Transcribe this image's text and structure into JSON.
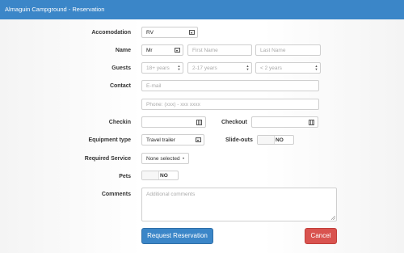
{
  "window": {
    "title": "Almaguin Campground - Reservation"
  },
  "form": {
    "accommodation": {
      "label": "Accomodation",
      "value": "RV"
    },
    "name": {
      "label": "Name",
      "title_value": "Mr",
      "first_placeholder": "First Name",
      "last_placeholder": "Last Name"
    },
    "guests": {
      "label": "Guests",
      "adults_placeholder": "18+ years",
      "children_placeholder": "2-17 years",
      "infants_placeholder": "< 2 years"
    },
    "contact": {
      "label": "Contact",
      "email_placeholder": "E-mail",
      "phone_placeholder": "Phone: (xxx) - xxx xxxx"
    },
    "checkin": {
      "label": "Checkin",
      "value": ""
    },
    "checkout": {
      "label": "Checkout",
      "value": ""
    },
    "equipment": {
      "label": "Equipment type",
      "value": "Travel trailer"
    },
    "slideouts": {
      "label": "Slide-outs",
      "value": "NO"
    },
    "service": {
      "label": "Required Service",
      "value": "None selected"
    },
    "pets": {
      "label": "Pets",
      "value": "NO"
    },
    "comments": {
      "label": "Comments",
      "placeholder": "Additional comments"
    }
  },
  "actions": {
    "submit_label": "Request Reservation",
    "cancel_label": "Cancel"
  },
  "colors": {
    "primary": "#3b86c8",
    "danger": "#d9534f"
  },
  "icons": {
    "select": "chevron-down-icon",
    "calendar": "calendar-icon",
    "spinner": "spinner-arrows-icon",
    "resize": "resize-grip-icon"
  }
}
